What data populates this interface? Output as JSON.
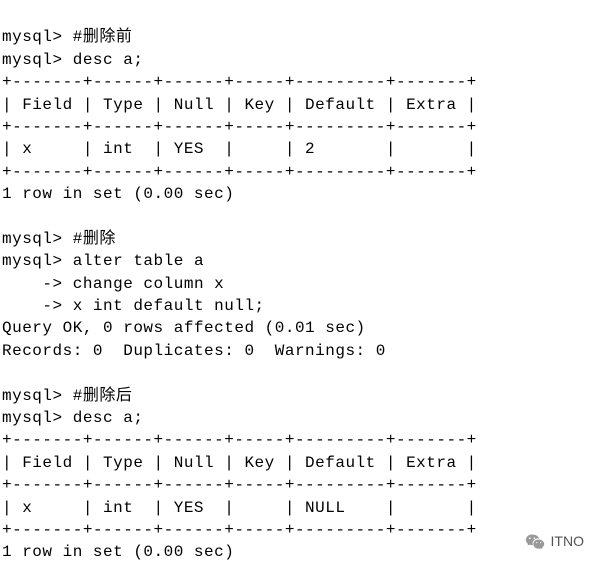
{
  "session": {
    "prompt": "mysql>",
    "continuation": "    ->",
    "commands": {
      "comment_before": "#删除前",
      "desc_a": "desc a;",
      "comment_delete": "#删除",
      "alter_line1": "alter table a",
      "alter_line2": "change column x",
      "alter_line3": "x int default null;",
      "comment_after": "#删除后"
    },
    "results": {
      "query_ok": "Query OK, 0 rows affected (0.01 sec)",
      "records_info": "Records: 0  Duplicates: 0  Warnings: 0",
      "row_in_set": "1 row in set (0.00 sec)"
    },
    "table_before": {
      "border_top": "+-------+------+------+-----+---------+-------+",
      "header_row": "| Field | Type | Null | Key | Default | Extra |",
      "border_mid": "+-------+------+------+-----+---------+-------+",
      "data_row": "| x     | int  | YES  |     | 2       |       |",
      "border_bottom": "+-------+------+------+-----+---------+-------+"
    },
    "table_after": {
      "border_top": "+-------+------+------+-----+---------+-------+",
      "header_row": "| Field | Type | Null | Key | Default | Extra |",
      "border_mid": "+-------+------+------+-----+---------+-------+",
      "data_row": "| x     | int  | YES  |     | NULL    |       |",
      "border_bottom": "+-------+------+------+-----+---------+-------+"
    }
  },
  "watermark": {
    "text": "ITNO"
  },
  "chart_data": {
    "type": "table",
    "tables": [
      {
        "title": "desc a (before delete)",
        "columns": [
          "Field",
          "Type",
          "Null",
          "Key",
          "Default",
          "Extra"
        ],
        "rows": [
          [
            "x",
            "int",
            "YES",
            "",
            "2",
            ""
          ]
        ]
      },
      {
        "title": "desc a (after delete)",
        "columns": [
          "Field",
          "Type",
          "Null",
          "Key",
          "Default",
          "Extra"
        ],
        "rows": [
          [
            "x",
            "int",
            "YES",
            "",
            "NULL",
            ""
          ]
        ]
      }
    ]
  }
}
